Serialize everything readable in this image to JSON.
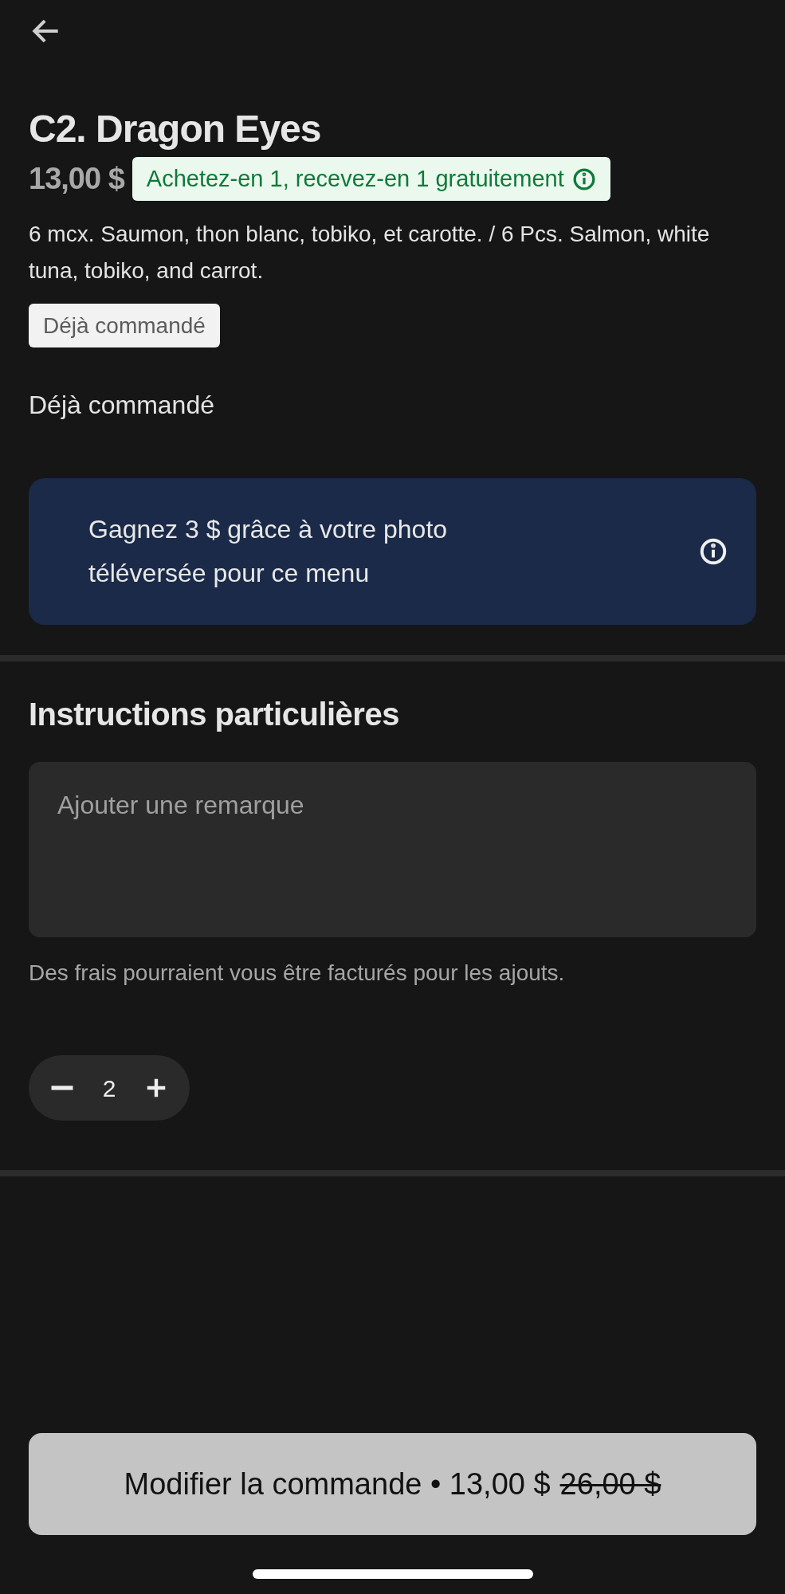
{
  "item": {
    "title": "C2. Dragon Eyes",
    "price": "13,00 $",
    "promo": "Achetez-en 1, recevez-en 1 gratuitement",
    "description": "6 mcx. Saumon, thon blanc, tobiko, et carotte. / 6 Pcs. Salmon, white tuna, tobiko, and carrot.",
    "badge": "Déjà commandé",
    "status": "Déjà commandé"
  },
  "photo_banner": {
    "text": "Gagnez 3 $ grâce à votre photo téléversée pour ce menu"
  },
  "instructions": {
    "heading": "Instructions particulières",
    "placeholder": "Ajouter une remarque",
    "note": "Des frais pourraient vous être facturés pour les ajouts."
  },
  "quantity": "2",
  "action": {
    "label": "Modifier la commande • 13,00 $",
    "original_price": "26,00 $"
  }
}
